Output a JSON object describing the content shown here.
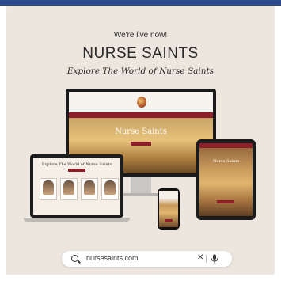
{
  "header": {
    "tagline": "We're live now!",
    "title": "NURSE SAINTS",
    "subtitle": "Explore The World of Nurse Saints"
  },
  "monitor": {
    "hero_title": "Nurse Saints"
  },
  "laptop": {
    "title": "Explore The World of Nurse Saints"
  },
  "tablet": {
    "hero_text": "Nurse Saints"
  },
  "search": {
    "value": "nursesaints.com",
    "icons": [
      "search-icon",
      "clear-icon",
      "mic-icon"
    ]
  },
  "colors": {
    "accent": "#8d1f28",
    "background": "#ece6df",
    "topbar": "#2f4a8a"
  }
}
